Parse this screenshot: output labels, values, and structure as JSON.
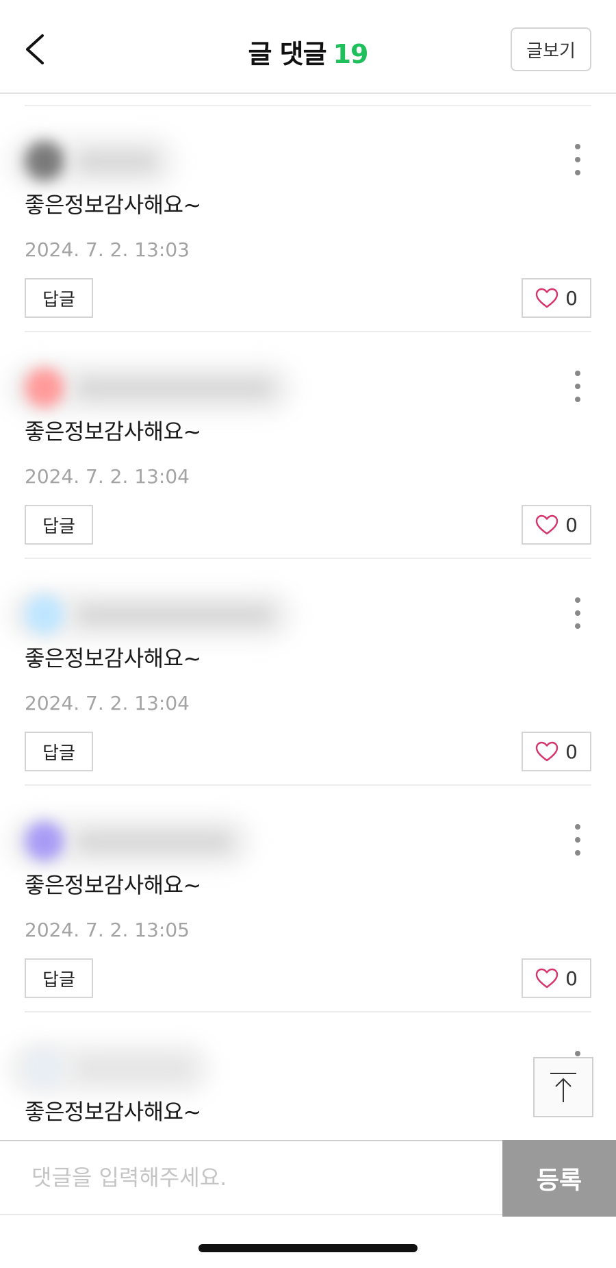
{
  "header": {
    "title": "글 댓글",
    "count": "19",
    "view_post_label": "글보기"
  },
  "comments": [
    {
      "text": "좋은정보감사해요~",
      "time": "2024. 7. 2. 13:03",
      "reply_label": "답글",
      "likes": "0",
      "avatar_color": "#7a7a7a"
    },
    {
      "text": "좋은정보감사해요~",
      "time": "2024. 7. 2. 13:04",
      "reply_label": "답글",
      "likes": "0",
      "avatar_color": "#ff9a9a"
    },
    {
      "text": "좋은정보감사해요~",
      "time": "2024. 7. 2. 13:04",
      "reply_label": "답글",
      "likes": "0",
      "avatar_color": "#bfe6ff"
    },
    {
      "text": "좋은정보감사해요~",
      "time": "2024. 7. 2. 13:05",
      "reply_label": "답글",
      "likes": "0",
      "avatar_color": "#a79cf5"
    },
    {
      "text": "좋은정보감사해요~",
      "time": "",
      "reply_label": "",
      "likes": "",
      "avatar_color": "#e8eef4"
    }
  ],
  "input": {
    "placeholder": "댓글을 입력해주세요.",
    "submit_label": "등록"
  },
  "colors": {
    "accent_green": "#1fbf5c",
    "heart": "#d6336c",
    "submit_bg": "#9a9a9a"
  },
  "icons": {
    "back": "chevron-left-icon",
    "more": "more-vertical-icon",
    "like": "heart-outline-icon",
    "scroll_top": "arrow-up-to-top-icon"
  }
}
